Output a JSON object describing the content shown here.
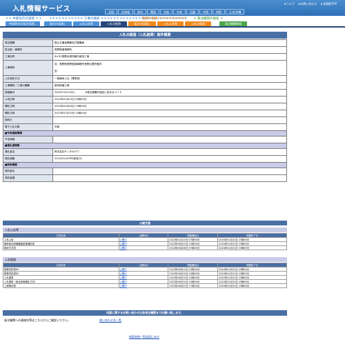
{
  "header": {
    "title": "入札情報サービス",
    "links": [
      "★ヘルプ",
      "★お問い合わせ",
      "★全国版TOP"
    ],
    "regions": [
      "全国",
      "北海道",
      "東北",
      "関東",
      "北陸",
      "中部",
      "近畿",
      "中国",
      "四国",
      "九州/沖縄"
    ]
  },
  "categories": [
    "＊＊ 中部地方の調達 ＊＊",
    "＊＊＊＊＊＊＊＊＊＊＊ 工事の検索 ＊＊＊＊＊＊＊＊＊＊＊＊＊＊＊＊＊＊＊＊＊＊＊＊＊＊＊＊",
    "業務の検索 ＊＊＊＊＊＊＊＊＊",
    "＊ 発注機関の検索 ＊"
  ],
  "tabs": [
    "中部地方の発注見通し",
    "発注の見通し",
    "入札公告等",
    "入札の経過",
    "発注の見通し",
    "入札公告等",
    "入札の経過",
    "発注機関情報"
  ],
  "panel_title": "入札の経過（入札結果）案件概要",
  "info_rows": [
    {
      "k": "発注機関",
      "v": "国土交通省関東地方整備局"
    },
    {
      "k": "担当部・事務所",
      "v": "長野国道事務所"
    },
    {
      "k": "工事名称",
      "v": "R4 R5長野出張所管内維持工事"
    },
    {
      "k": "工事場所",
      "v": "自：長野県長野国道事務所長野出張所管内",
      "v2": "至："
    },
    {
      "k": "入札契約方式",
      "v": "一般競争入札（標準型）"
    },
    {
      "k": "工事種別／工事の種類",
      "v": "維持修繕工事"
    },
    {
      "k": "調達番号",
      "v": "2022070511001　　　　※発注機関が独自に定めるコード"
    },
    {
      "k": "公告日時",
      "v": "2022年01月14日 00時00分"
    },
    {
      "k": "開札日時",
      "v": "2022年01月26日 23時00分"
    },
    {
      "k": "開札日時",
      "v": "2022年07月10日 10時44分"
    },
    {
      "k": "契約日",
      "v": ""
    },
    {
      "k": "電子入札対象",
      "v": "対象"
    }
  ],
  "sections": {
    "yotei": "■予定価格情報",
    "yotei_row": "予定価格",
    "rakusatsu": "■落札者情報",
    "rakusatsu_rows": [
      {
        "k": "落札者名",
        "v": "株式会社サンタキザワ"
      },
      {
        "k": "落札価格",
        "v": "223,000,000円(税抜き)"
      }
    ],
    "keiyaku": "■契約情報",
    "keiyaku_rows": [
      "契約者名",
      "契約金額"
    ]
  },
  "docs": {
    "title": "公開文書",
    "headers": [
      "文書名称",
      "公開状況",
      "掲載開始日",
      "掲載終了日"
    ],
    "group1": {
      "title": "入札公告等",
      "rows": [
        [
          "入札公告",
          "公開中",
          "2022年01月14日 07時00分",
          "2024年01月31日 23時00分"
        ],
        [
          "競争参加資格確認結果通知書",
          "公開中",
          "2022年06月13日 10時00分",
          "2024年01月31日 23時00分"
        ],
        [
          "契約方式書",
          "公開中",
          "2022年06月28日 07時00分",
          "2024年01月31日 23時00分"
        ]
      ]
    },
    "group2": {
      "title": "入札経過",
      "rows": [
        [
          "積算内訳書R4",
          "公開中",
          "2022年06月13日 10時00分",
          "2024年01月31日 23時00分"
        ],
        [
          "積算内訳書R5",
          "公開中",
          "2022年06月13日 10時00分",
          "2024年01月31日 23時00分"
        ],
        [
          "入札調書",
          "公開中",
          "2022年06月13日 10時00分",
          "2024年01月31日 23時00分"
        ],
        [
          "入札調書（総合評価落札方式）",
          "公開中",
          "2022年06月13日 10時00分",
          "2024年01月31日 23時00分"
        ],
        [
          "工事契約書",
          "公開中",
          "2022年06月22日 17時20分",
          "2024年01月31日 23時00分"
        ]
      ]
    }
  },
  "footer": {
    "title": "内容に関するお問い合わせは各発注機関までお願い致します。",
    "text": "発注機関への連絡先等はこちらからご確認ください。",
    "link": "問い合わせ先一覧",
    "back": "検索結果一覧画面に戻る"
  }
}
